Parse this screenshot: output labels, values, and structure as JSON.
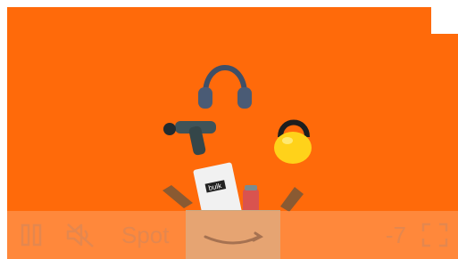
{
  "player": {
    "sponsor_label": "Spot",
    "time_remaining": "-7",
    "background_color": "#ff6a0a",
    "control_color": "#e4874e"
  },
  "icons": {
    "pause": "pause-icon",
    "mute": "mute-icon",
    "fullscreen": "fullscreen-icon"
  },
  "scene": {
    "package_brand": "bulk",
    "box_logo": "amazon-smile-logo"
  }
}
